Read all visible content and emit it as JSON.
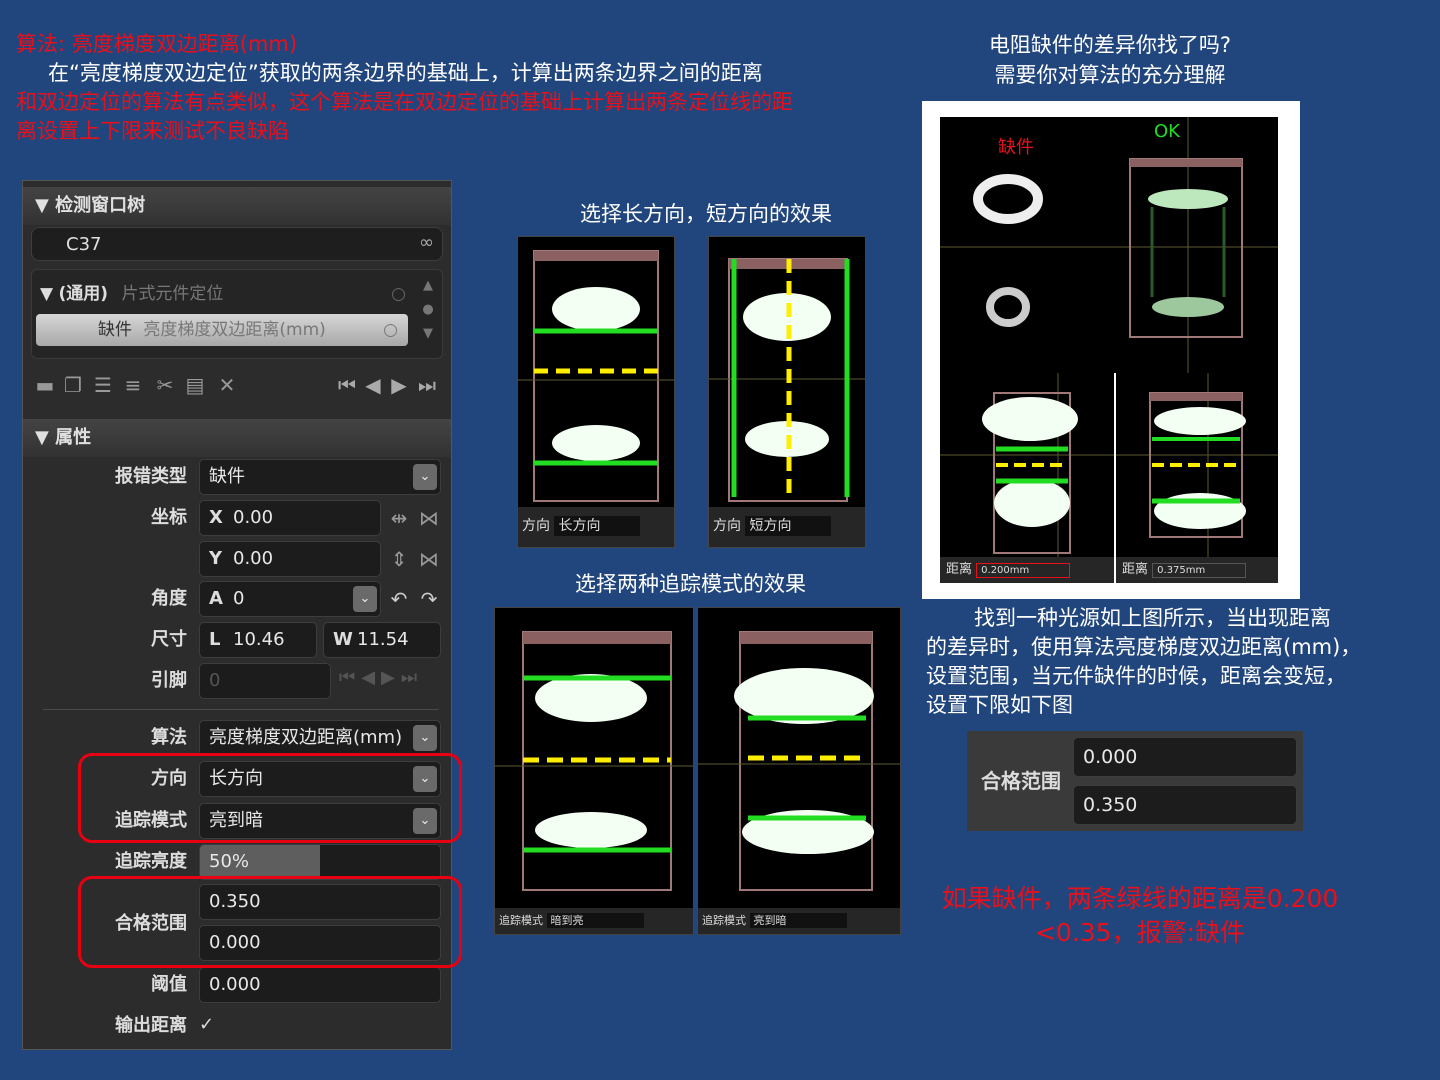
{
  "intro": {
    "line1": "算法: 亮度梯度双边距离(mm)",
    "line2": "在“亮度梯度双边定位”获取的两条边界的基础上，计算出两条边界之间的距离",
    "line3": "和双边定位的算法有点类似，这个算法是在双边定位的基础上计算出两条定位线的距",
    "line4": "离设置上下限来测试不良缺陷"
  },
  "right_title": {
    "line1": "电阻缺件的差异你找了吗?",
    "line2": "需要你对算法的充分理解"
  },
  "tree": {
    "title": "检测窗口树",
    "component": "C37",
    "node1_prefix": "(通用)",
    "node1_label": "片式元件定位",
    "node2_prefix": "缺件",
    "node2_label": "亮度梯度双边距离(mm)"
  },
  "props": {
    "title": "属性",
    "error_type_label": "报错类型",
    "error_type_value": "缺件",
    "coord_label": "坐标",
    "x_prefix": "X",
    "x_value": "0.00",
    "y_prefix": "Y",
    "y_value": "0.00",
    "angle_label": "角度",
    "angle_prefix": "A",
    "angle_value": "0",
    "size_label": "尺寸",
    "l_prefix": "L",
    "l_value": "10.46",
    "w_prefix": "W",
    "w_value": "11.54",
    "pin_label": "引脚",
    "pin_value": "0",
    "algo_label": "算法",
    "algo_value": "亮度梯度双边距离(mm)",
    "direction_label": "方向",
    "direction_value": "长方向",
    "track_mode_label": "追踪模式",
    "track_mode_value": "亮到暗",
    "track_bright_label": "追踪亮度",
    "track_bright_value": "50%",
    "track_bright_level": 0.5,
    "range_label": "合格范围",
    "range_upper": "0.350",
    "range_lower": "0.000",
    "threshold_label": "阈值",
    "threshold_value": "0.000",
    "output_label": "输出距离",
    "output_checked": "✓"
  },
  "mid": {
    "caption1": "选择长方向，短方向的效果",
    "img1_label": "方向",
    "img1_value": "长方向",
    "img2_label": "方向",
    "img2_value": "短方向",
    "caption2": "选择两种追踪模式的效果",
    "img3_label": "追踪模式",
    "img3_value": "暗到亮",
    "img4_label": "追踪模式",
    "img4_value": "亮到暗"
  },
  "rightimg": {
    "label_defect": "缺件",
    "label_ok": "OK",
    "dist_label1": "距离",
    "dist_value1": "0.200mm",
    "dist_label2": "距离",
    "dist_value2": "0.375mm"
  },
  "explain": {
    "line1": "找到一种光源如上图所示，当出现距离",
    "line2": "的差异时，使用算法亮度梯度双边距离(mm)，",
    "line3": "设置范围，当元件缺件的时候，距离会变短，",
    "line4": "设置下限如下图"
  },
  "range_box": {
    "label": "合格范围",
    "v1": "0.000",
    "v2": "0.350"
  },
  "conclusion": {
    "line1": "如果缺件，两条绿线的距离是0.200",
    "line2": "<0.35，报警:缺件"
  },
  "colors": {
    "background": "#21467d",
    "red": "#e8101a",
    "green_line": "#22dd22",
    "yellow_line": "#ffee00"
  }
}
